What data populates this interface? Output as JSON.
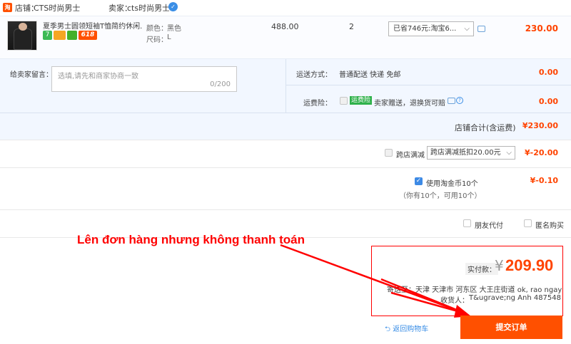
{
  "store": {
    "logo_text": "淘",
    "shop_label": "店铺：",
    "shop_name": "CTS时尚男士",
    "seller_label": "卖家：",
    "seller_name": "cts时尚男士"
  },
  "item": {
    "title": "夏季男士圆领短袖T恤简约休闲...",
    "badges": [
      "7",
      "",
      "",
      "618"
    ],
    "color_label": "颜色：",
    "color_value": "黑色",
    "size_label": "尺码：",
    "size_value": "L",
    "price": "488.00",
    "quantity": "2",
    "discount_select": "已省746元:淘宝6...",
    "total": "230.00"
  },
  "shipping": {
    "remark_label": "给卖家留言：",
    "remark_placeholder": "选填,请先和商家协商一致",
    "remark_count": "0/200",
    "method_label": "运送方式：",
    "method_value": "普通配送 快递 免邮",
    "method_price": "0.00",
    "insurance_label": "运费险：",
    "insurance_badge": "运费险",
    "insurance_text": "卖家赠送，退换货可赔",
    "insurance_price": "0.00",
    "store_total_label": "店铺合计(含运费)",
    "store_total_value": "¥230.00"
  },
  "discounts": {
    "cross_store_label": "跨店满减",
    "cross_store_select": "跨店满减抵扣20.00元",
    "cross_store_value": "¥-20.00",
    "coin_label": "使用淘金币10个",
    "coin_sub": "（你有10个，可用10个）",
    "coin_value": "¥-0.10",
    "friend_pay_label": "朋友代付",
    "anonymous_label": "匿名购买"
  },
  "annotation": "Lên đơn hàng nhưng không thanh toán",
  "summary": {
    "pay_label": "实付款：",
    "currency": "¥",
    "amount": "209.90",
    "address_label": "寄送至：",
    "address": "天津 天津市 河东区 大王庄街道 ok, rao ngay",
    "receiver_label": "收货人：",
    "receiver": "T&ugrave;ng Anh 487548"
  },
  "actions": {
    "back_to_cart": "返回购物车",
    "submit": "提交订单"
  },
  "colors": {
    "accent": "#ff5000",
    "price_red": "#ff4400",
    "annotation_red": "#ff0000",
    "link_blue": "#3a8ee6"
  }
}
